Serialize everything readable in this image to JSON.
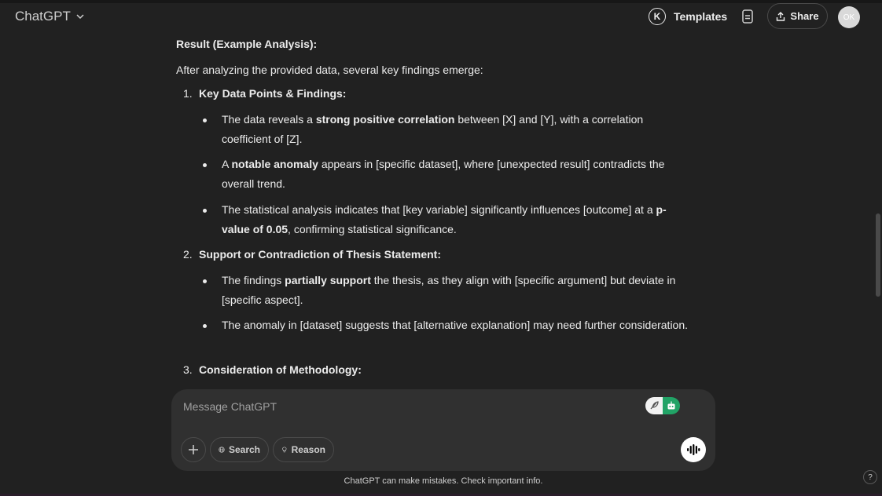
{
  "header": {
    "app_title": "ChatGPT",
    "templates_logo": "K",
    "templates_label": "Templates",
    "share_label": "Share",
    "avatar_initials": "OK"
  },
  "message": {
    "result_heading": "Result (Example Analysis):",
    "intro": "After analyzing the provided data, several key findings emerge:",
    "items": [
      {
        "number": "1.",
        "heading": "Key Data Points & Findings:",
        "bullets": [
          [
            {
              "t": "The data reveals a "
            },
            {
              "t": "strong positive correlation",
              "b": true
            },
            {
              "t": " between [X] and [Y], with a correlation coefficient of [Z]."
            }
          ],
          [
            {
              "t": "A "
            },
            {
              "t": "notable anomaly",
              "b": true
            },
            {
              "t": " appears in [specific dataset], where [unexpected result] contradicts the overall trend."
            }
          ],
          [
            {
              "t": "The statistical analysis indicates that [key variable] significantly influences [outcome] at a "
            },
            {
              "t": "p-value of 0.05",
              "b": true
            },
            {
              "t": ", confirming statistical significance."
            }
          ]
        ]
      },
      {
        "number": "2.",
        "heading": "Support or Contradiction of Thesis Statement:",
        "bullets": [
          [
            {
              "t": "The findings "
            },
            {
              "t": "partially support",
              "b": true
            },
            {
              "t": " the thesis, as they align with [specific argument] but deviate in [specific aspect]."
            }
          ],
          [
            {
              "t": "The anomaly in [dataset] suggests that [alternative explanation] may need further consideration."
            }
          ]
        ]
      },
      {
        "number": "3.",
        "heading": "Consideration of Methodology:",
        "bullets": []
      }
    ]
  },
  "composer": {
    "placeholder": "Message ChatGPT",
    "search_label": "Search",
    "reason_label": "Reason"
  },
  "footer": {
    "disclaimer": "ChatGPT can make mistakes. Check important info.",
    "help_label": "?"
  },
  "colors": {
    "background": "#212121",
    "composer_bg": "#303030",
    "extension_green": "#21a366"
  }
}
